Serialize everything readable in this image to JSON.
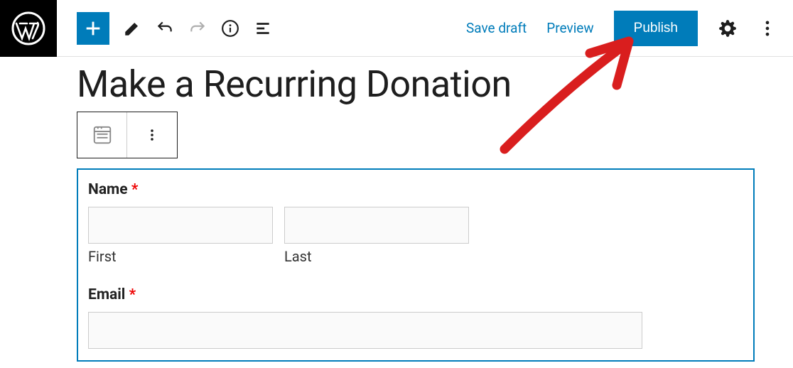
{
  "toolbar": {
    "save_draft": "Save draft",
    "preview": "Preview",
    "publish": "Publish"
  },
  "page": {
    "title": "Make a Recurring Donation"
  },
  "form": {
    "name_label": "Name",
    "email_label": "Email",
    "required": "*",
    "first_sublabel": "First",
    "last_sublabel": "Last"
  }
}
